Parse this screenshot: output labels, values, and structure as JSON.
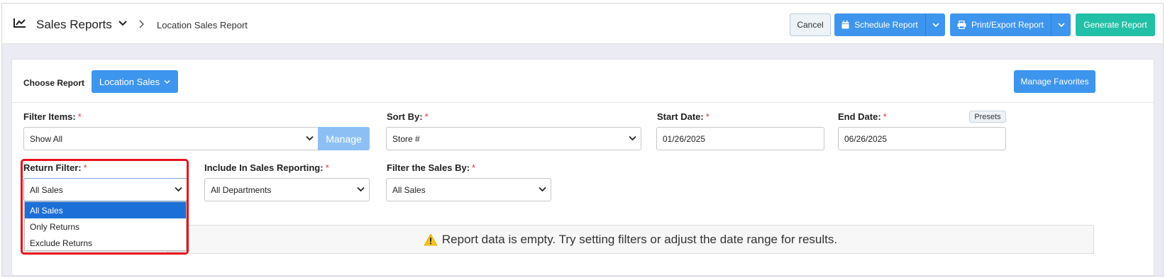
{
  "header": {
    "title": "Sales Reports",
    "breadcrumb": "Location Sales Report",
    "cancel_label": "Cancel",
    "schedule_label": "Schedule Report",
    "print_label": "Print/Export Report",
    "generate_label": "Generate Report"
  },
  "report": {
    "choose_label": "Choose Report",
    "selected_report": "Location Sales",
    "favorites_label": "Manage Favorites"
  },
  "filters": {
    "filter_items_label": "Filter Items:",
    "filter_items_value": "Show All",
    "manage_label": "Manage",
    "sort_by_label": "Sort By:",
    "sort_by_value": "Store #",
    "start_date_label": "Start Date:",
    "start_date_value": "01/26/2025",
    "end_date_label": "End Date:",
    "end_date_value": "06/26/2025",
    "presets_label": "Presets",
    "return_filter_label": "Return Filter:",
    "return_filter_value": "All Sales",
    "include_label": "Include In Sales Reporting:",
    "include_value": "All Departments",
    "filter_sales_label": "Filter the Sales By:",
    "filter_sales_value": "All Sales",
    "required_mark": "*"
  },
  "return_filter_options": [
    "All Sales",
    "Only Returns",
    "Exclude Returns"
  ],
  "message": {
    "empty": "Report data is empty. Try setting filters or adjust the date range for results."
  },
  "colors": {
    "primary": "#3d95ee",
    "generate": "#22c0a6",
    "selected_option": "#1c6fd6",
    "highlight": "#e8141c",
    "warning": "#f5c518"
  }
}
